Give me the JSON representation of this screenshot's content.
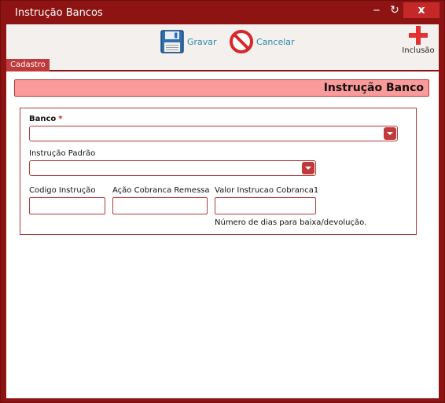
{
  "window": {
    "title": "Instrução Bancos",
    "minimize_glyph": "‒",
    "refresh_glyph": "↻",
    "close_glyph": "x"
  },
  "toolbar": {
    "save_label": "Gravar",
    "save_icon": "floppy-disk-icon",
    "cancel_label": "Cancelar",
    "cancel_icon": "no-entry-icon",
    "new_label": "Inclusão",
    "new_icon": "plus-icon"
  },
  "tabs": [
    {
      "label": "Cadastro",
      "active": true
    }
  ],
  "section": {
    "title": "Instrução Banco"
  },
  "form": {
    "banco": {
      "label": "Banco",
      "required_mark": "*",
      "value": ""
    },
    "instrucao_padrao": {
      "label": "Instrução Padrão",
      "value": ""
    },
    "codigo_instrucao": {
      "label": "Codigo Instrução",
      "value": ""
    },
    "acao_cobranca_remessa": {
      "label": "Ação Cobranca Remessa",
      "value": ""
    },
    "valor_instrucao_cobranca1": {
      "label": "Valor Instrucao Cobranca1",
      "value": "",
      "hint": "Número de dias para baixa/devolução."
    }
  },
  "colors": {
    "frame": "#8e1414",
    "accent": "#c0393b",
    "header_fill": "#fa9a9a",
    "link": "#2a8aa8"
  }
}
